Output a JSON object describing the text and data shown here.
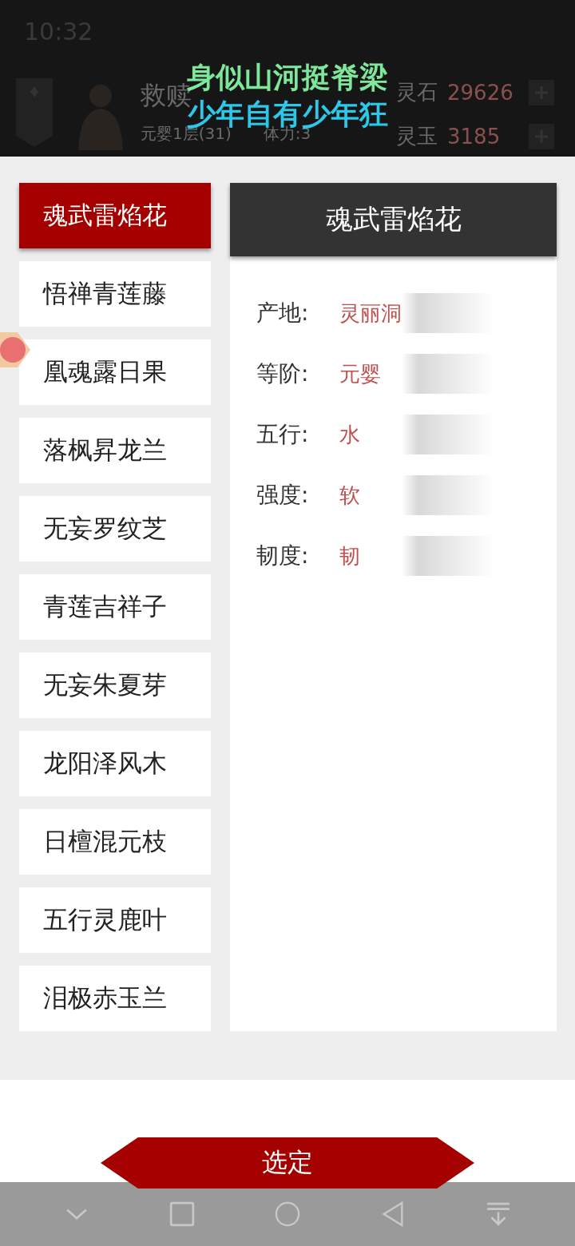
{
  "status_bar": {
    "time": "10:32"
  },
  "player": {
    "name": "救赎",
    "level": "元婴1层(31)",
    "stamina": "体力:3",
    "currencies": [
      {
        "label": "灵石",
        "value": "29626"
      },
      {
        "label": "灵玉",
        "value": "3185"
      }
    ]
  },
  "caption": [
    "身似山河挺脊梁",
    "少年自有少年狂"
  ],
  "herbs": [
    {
      "name": "魂武雷焰花",
      "selected": true
    },
    {
      "name": "悟禅青莲藤",
      "selected": false
    },
    {
      "name": "凰魂露日果",
      "selected": false
    },
    {
      "name": "落枫昇龙兰",
      "selected": false
    },
    {
      "name": "无妄罗纹芝",
      "selected": false
    },
    {
      "name": "青莲吉祥子",
      "selected": false
    },
    {
      "name": "无妄朱夏芽",
      "selected": false
    },
    {
      "name": "龙阳泽风木",
      "selected": false
    },
    {
      "name": "日檀混元枝",
      "selected": false
    },
    {
      "name": "五行灵鹿叶",
      "selected": false
    },
    {
      "name": "泪极赤玉兰",
      "selected": false
    }
  ],
  "detail": {
    "title": "魂武雷焰花",
    "attributes": [
      {
        "label": "产地:",
        "value": "灵丽洞"
      },
      {
        "label": "等阶:",
        "value": "元婴"
      },
      {
        "label": "五行:",
        "value": "水"
      },
      {
        "label": "强度:",
        "value": "软"
      },
      {
        "label": "韧度:",
        "value": "韧"
      }
    ]
  },
  "confirm_button": "选定"
}
